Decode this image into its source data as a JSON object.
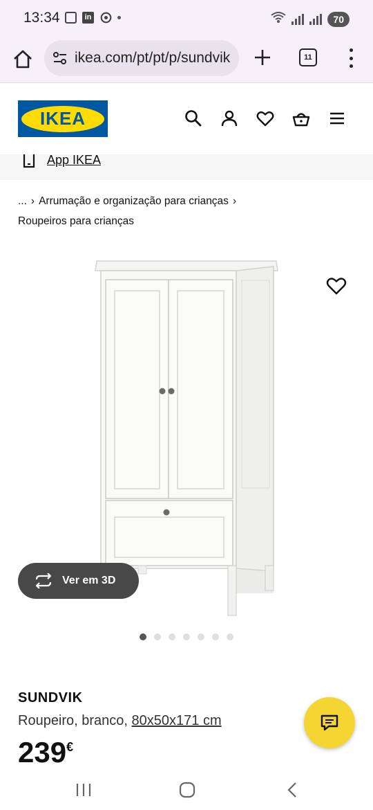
{
  "status_bar": {
    "time": "13:34",
    "battery": "70",
    "icons": [
      "screenshot-icon",
      "linkedin-icon",
      "chrome-icon",
      "wifi-icon",
      "signal-icon",
      "signal-icon"
    ]
  },
  "browser": {
    "url": "ikea.com/pt/pt/p/sundvik",
    "tab_count": "11"
  },
  "header": {
    "logo_text": "IKEA",
    "brand_blue": "#0058a3",
    "brand_yellow": "#ffdb00",
    "icons": [
      "search-icon",
      "user-icon",
      "heart-icon",
      "basket-icon",
      "hamburger-menu-icon"
    ]
  },
  "app_banner": {
    "label": "App IKEA"
  },
  "breadcrumb": {
    "ellipsis": "...",
    "items": [
      "Arrumação e organização para crianças",
      "Roupeiros para crianças"
    ]
  },
  "product": {
    "view3d_label": "Ver em 3D",
    "carousel": {
      "count": 7,
      "active_index": 0
    },
    "name": "SUNDVIK",
    "description": "Roupeiro, branco,",
    "size": "80x50x171 cm",
    "price": "239",
    "currency": "€"
  },
  "chat": {
    "color": "#f5d531"
  }
}
